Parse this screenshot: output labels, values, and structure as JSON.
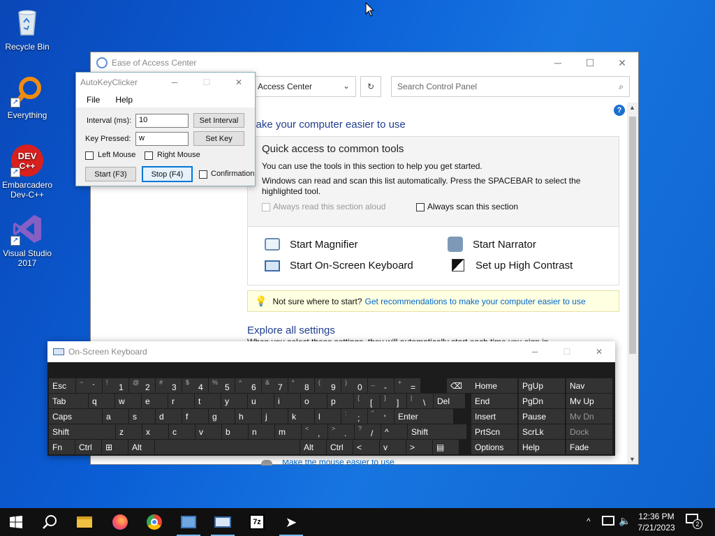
{
  "desktop": {
    "icons": [
      {
        "label": "Recycle Bin"
      },
      {
        "label": "Everything"
      },
      {
        "label": "Embarcadero Dev-C++"
      },
      {
        "label": "Visual Studio 2017"
      }
    ]
  },
  "ease_of_access": {
    "title": "Ease of Access Center",
    "address": "Access Center",
    "search_placeholder": "Search Control Panel",
    "heading": "Make your computer easier to use",
    "quick_access_title": "Quick access to common tools",
    "quick_access_desc": "You can use the tools in this section to help you get started.",
    "scan_desc": "Windows can read and scan this list automatically.  Press the SPACEBAR to select the highlighted tool.",
    "always_read": "Always read this section aloud",
    "always_scan": "Always scan this section",
    "tools": [
      "Start Magnifier",
      "Start Narrator",
      "Start On-Screen Keyboard",
      "Set up High Contrast"
    ],
    "tip_prefix": "Not sure where to start?",
    "tip_link": "Get recommendations to make your computer easier to use",
    "explore_heading": "Explore all settings",
    "explore_desc": "When you select these settings, they will automatically start each time you sign in.",
    "mouse_link": "Make the mouse easier to use"
  },
  "autokeyclicker": {
    "title": "AutoKeyClicker",
    "menu": [
      "File",
      "Help"
    ],
    "interval_label": "Interval (ms):",
    "interval_value": "10",
    "set_interval": "Set Interval",
    "key_label": "Key Pressed:",
    "key_value": "w",
    "set_key": "Set Key",
    "left_mouse": "Left Mouse",
    "right_mouse": "Right Mouse",
    "start": "Start (F3)",
    "stop": "Stop (F4)",
    "confirmation": "Confirmation"
  },
  "osk": {
    "title": "On-Screen Keyboard",
    "side_keys": [
      [
        "Home",
        "PgUp",
        "Nav"
      ],
      [
        "End",
        "PgDn",
        "Mv Up"
      ],
      [
        "Insert",
        "Pause",
        "Mv Dn"
      ],
      [
        "PrtScn",
        "ScrLk",
        "Dock"
      ],
      [
        "Options",
        "Help",
        "Fade"
      ]
    ],
    "row1": [
      "Esc",
      "`",
      "1",
      "2",
      "3",
      "4",
      "5",
      "6",
      "7",
      "8",
      "9",
      "0",
      "-",
      "="
    ],
    "row1_shift": [
      "",
      "~",
      "!",
      "@",
      "#",
      "$",
      "%",
      "^",
      "&",
      "*",
      "(",
      ")",
      "_",
      "+"
    ],
    "row2": [
      "Tab",
      "q",
      "w",
      "e",
      "r",
      "t",
      "y",
      "u",
      "i",
      "o",
      "p",
      "[",
      "]",
      "\\",
      "Del"
    ],
    "row2_shift": [
      "",
      "",
      "",
      "",
      "",
      "",
      "",
      "",
      "",
      "",
      "",
      "{",
      "}",
      "|",
      ""
    ],
    "row3": [
      "Caps",
      "a",
      "s",
      "d",
      "f",
      "g",
      "h",
      "j",
      "k",
      "l",
      ";",
      "'",
      "Enter"
    ],
    "row3_shift": [
      "",
      "",
      "",
      "",
      "",
      "",
      "",
      "",
      "",
      "",
      ":",
      "\"",
      ""
    ],
    "row4": [
      "Shift",
      "z",
      "x",
      "c",
      "v",
      "b",
      "n",
      "m",
      ",",
      ".",
      "/",
      "^",
      "Shift"
    ],
    "row4_shift": [
      "",
      "",
      "",
      "",
      "",
      "",
      "",
      "",
      "<",
      ">",
      "?",
      "",
      ""
    ],
    "row5": [
      "Fn",
      "Ctrl",
      "⊞",
      "Alt",
      "",
      "Alt",
      "Ctrl",
      "<",
      "v",
      ">",
      "▤"
    ]
  },
  "taskbar": {
    "time": "12:36 PM",
    "date": "7/21/2023",
    "notifications": "2"
  },
  "colors": {
    "accent": "#0078d7",
    "link": "#0066cc",
    "heading": "#1e3d8f",
    "osk_bg": "#1c1c1c",
    "osk_key": "#333333"
  }
}
